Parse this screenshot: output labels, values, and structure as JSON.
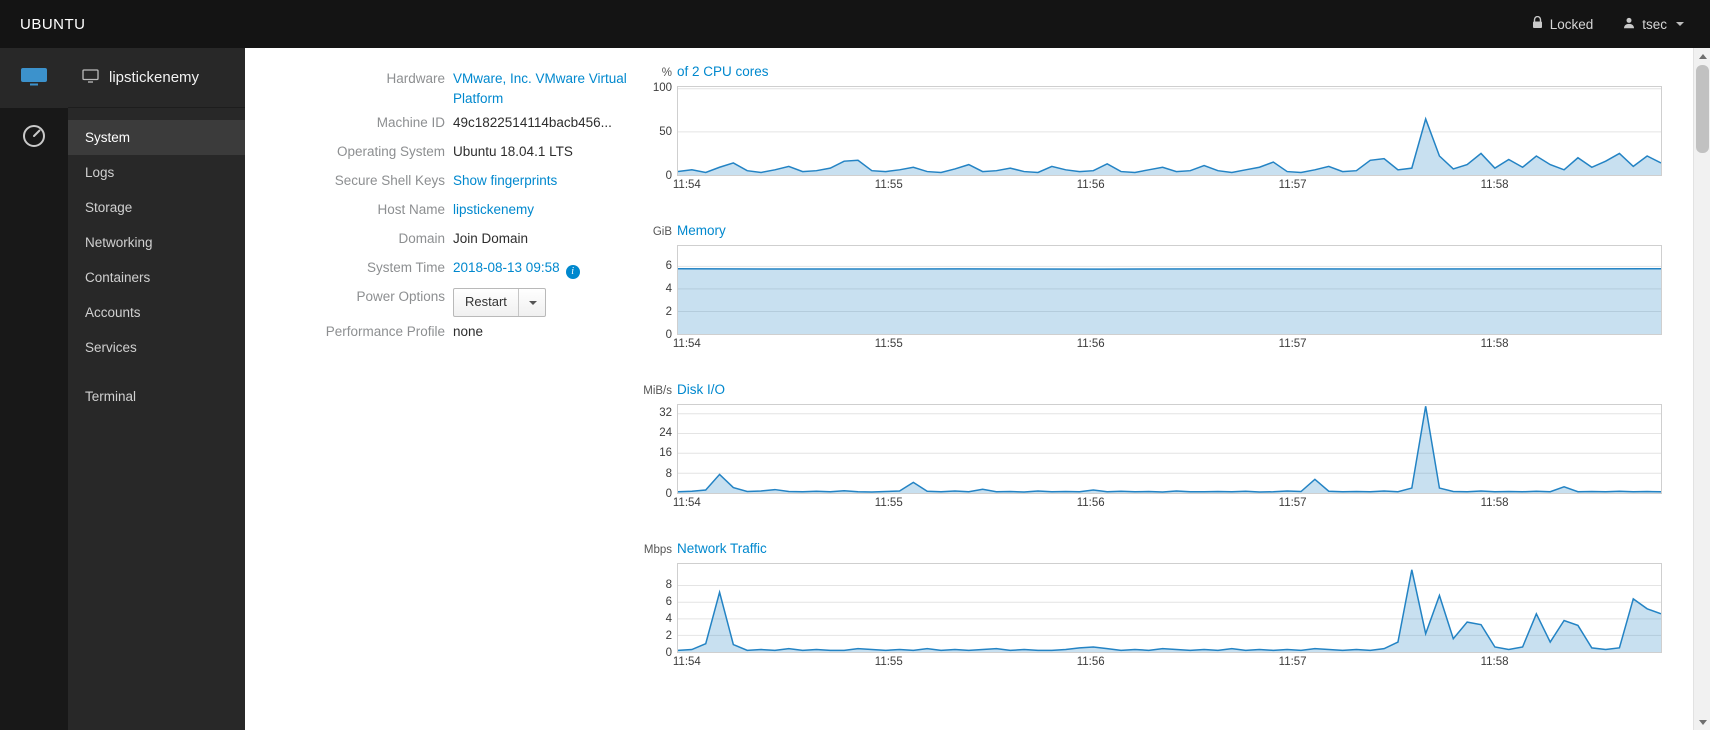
{
  "topbar": {
    "brand": "UBUNTU",
    "locked": "Locked",
    "user": "tsec"
  },
  "sidebar": {
    "host": "lipstickenemy",
    "selected": "System",
    "items": [
      "System",
      "Logs",
      "Storage",
      "Networking",
      "Containers",
      "Accounts",
      "Services"
    ],
    "terminal": "Terminal"
  },
  "details": {
    "rows": [
      {
        "label": "Hardware",
        "value": "VMware, Inc. VMware Virtual Platform",
        "kind": "link"
      },
      {
        "label": "Machine ID",
        "value": "49c1822514114bacb456...",
        "kind": "text"
      },
      {
        "label": "Operating System",
        "value": "Ubuntu 18.04.1 LTS",
        "kind": "text"
      },
      {
        "label": "Secure Shell Keys",
        "value": "Show fingerprints",
        "kind": "link"
      },
      {
        "label": "Host Name",
        "value": "lipstickenemy",
        "kind": "link"
      },
      {
        "label": "Domain",
        "value": "Join Domain",
        "kind": "text"
      },
      {
        "label": "System Time",
        "value": "2018-08-13 09:58",
        "kind": "link_info"
      },
      {
        "label": "Power Options",
        "value": "Restart",
        "kind": "power"
      },
      {
        "label": "Performance Profile",
        "value": "none",
        "kind": "text"
      }
    ]
  },
  "colors": {
    "accent": "#0088ce",
    "chart_line": "#2383c4",
    "chart_fill": "rgba(35,131,196,0.25)",
    "grid": "#e4e4e4",
    "border": "#cfcfcf"
  },
  "chart_data": [
    {
      "id": "cpu",
      "type": "area",
      "unit": "%",
      "title": "of 2 CPU cores",
      "x_ticks": [
        "11:54",
        "11:55",
        "11:56",
        "11:57",
        "11:58"
      ],
      "y_ticks": [
        0,
        50,
        100
      ],
      "ymax": 102,
      "values": [
        4,
        6,
        3,
        9,
        14,
        5,
        3,
        6,
        10,
        4,
        5,
        8,
        16,
        17,
        5,
        4,
        6,
        9,
        4,
        3,
        7,
        12,
        4,
        5,
        8,
        4,
        3,
        10,
        6,
        4,
        5,
        13,
        4,
        3,
        6,
        9,
        4,
        5,
        11,
        5,
        3,
        6,
        9,
        15,
        4,
        3,
        6,
        10,
        4,
        5,
        17,
        19,
        6,
        8,
        65,
        22,
        7,
        12,
        25,
        8,
        18,
        9,
        22,
        12,
        6,
        20,
        9,
        16,
        25,
        10,
        22,
        14
      ]
    },
    {
      "id": "memory",
      "type": "area",
      "unit": "GiB",
      "title": "Memory",
      "x_ticks": [
        "11:54",
        "11:55",
        "11:56",
        "11:57",
        "11:58"
      ],
      "y_ticks": [
        0,
        2,
        4,
        6
      ],
      "ymax": 7.8,
      "values": [
        5.78,
        5.76,
        5.77,
        5.75,
        5.77,
        5.76,
        5.77,
        5.78
      ]
    },
    {
      "id": "disk",
      "type": "area",
      "unit": "MiB/s",
      "title": "Disk I/O",
      "x_ticks": [
        "11:54",
        "11:55",
        "11:56",
        "11:57",
        "11:58"
      ],
      "y_ticks": [
        0,
        8,
        16,
        24,
        32
      ],
      "ymax": 35.5,
      "values": [
        0.5,
        0.7,
        1.2,
        7.5,
        2.2,
        0.6,
        0.8,
        1.4,
        0.6,
        0.5,
        0.7,
        0.5,
        0.9,
        0.5,
        0.4,
        0.6,
        0.8,
        4.3,
        0.7,
        0.5,
        0.8,
        0.5,
        1.5,
        0.5,
        0.6,
        0.4,
        0.8,
        0.5,
        0.6,
        0.5,
        1.2,
        0.5,
        0.7,
        0.5,
        0.6,
        0.4,
        0.8,
        0.5,
        0.5,
        0.6,
        0.5,
        0.7,
        0.4,
        0.5,
        0.8,
        0.6,
        5.5,
        0.7,
        0.5,
        0.6,
        0.5,
        0.8,
        0.5,
        2.0,
        35,
        2.0,
        0.6,
        0.5,
        0.8,
        0.5,
        0.6,
        0.5,
        0.7,
        0.5,
        2.5,
        0.5,
        0.6,
        0.5,
        0.7,
        0.5,
        0.6,
        0.5
      ]
    },
    {
      "id": "network",
      "type": "area",
      "unit": "Mbps",
      "title": "Network Traffic",
      "x_ticks": [
        "11:54",
        "11:55",
        "11:56",
        "11:57",
        "11:58"
      ],
      "y_ticks": [
        0,
        2,
        4,
        6,
        8
      ],
      "ymax": 10.6,
      "values": [
        0.2,
        0.3,
        1.0,
        7.2,
        0.9,
        0.2,
        0.3,
        0.2,
        0.4,
        0.2,
        0.3,
        0.2,
        0.2,
        0.4,
        0.3,
        0.2,
        0.3,
        0.2,
        0.4,
        0.2,
        0.3,
        0.2,
        0.3,
        0.4,
        0.2,
        0.3,
        0.2,
        0.2,
        0.3,
        0.5,
        0.6,
        0.4,
        0.2,
        0.3,
        0.2,
        0.4,
        0.3,
        0.2,
        0.3,
        0.2,
        0.4,
        0.2,
        0.3,
        0.2,
        0.3,
        0.2,
        0.4,
        0.3,
        0.2,
        0.3,
        0.2,
        0.4,
        1.2,
        9.9,
        2.2,
        6.8,
        1.6,
        3.6,
        3.3,
        0.6,
        0.3,
        0.6,
        4.6,
        1.2,
        3.8,
        3.2,
        0.5,
        0.3,
        0.5,
        6.4,
        5.2,
        4.6
      ]
    }
  ]
}
